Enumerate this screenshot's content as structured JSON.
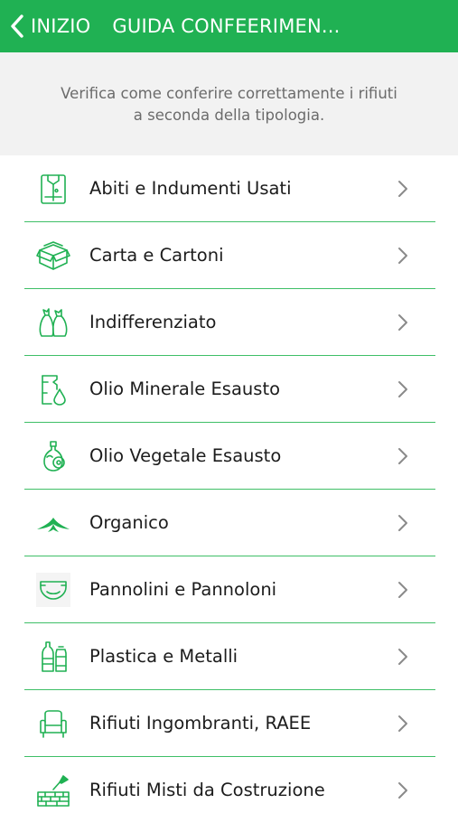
{
  "header": {
    "back_label": "INIZIO",
    "title": "GUIDA CONFEERIMEN...",
    "background": "#20b153"
  },
  "intro": {
    "text": "Verifica come conferire correttamente i rifiuti a seconda della tipologia."
  },
  "accent_color": "#20b153",
  "categories": [
    {
      "label": "Abiti e Indumenti Usati",
      "icon": "clothing-icon"
    },
    {
      "label": "Carta e Cartoni",
      "icon": "cardboard-box-icon"
    },
    {
      "label": "Indifferenziato",
      "icon": "trash-bags-icon"
    },
    {
      "label": "Olio Minerale Esausto",
      "icon": "mineral-oil-icon"
    },
    {
      "label": "Olio Vegetale Esausto",
      "icon": "vegetable-oil-icon"
    },
    {
      "label": "Organico",
      "icon": "organic-leaves-icon"
    },
    {
      "label": "Pannolini e Pannoloni",
      "icon": "diaper-icon"
    },
    {
      "label": "Plastica e Metalli",
      "icon": "bottles-cans-icon"
    },
    {
      "label": "Rifiuti Ingombranti, RAEE",
      "icon": "armchair-icon"
    },
    {
      "label": "Rifiuti Misti da Costruzione",
      "icon": "bricks-trowel-icon"
    }
  ]
}
